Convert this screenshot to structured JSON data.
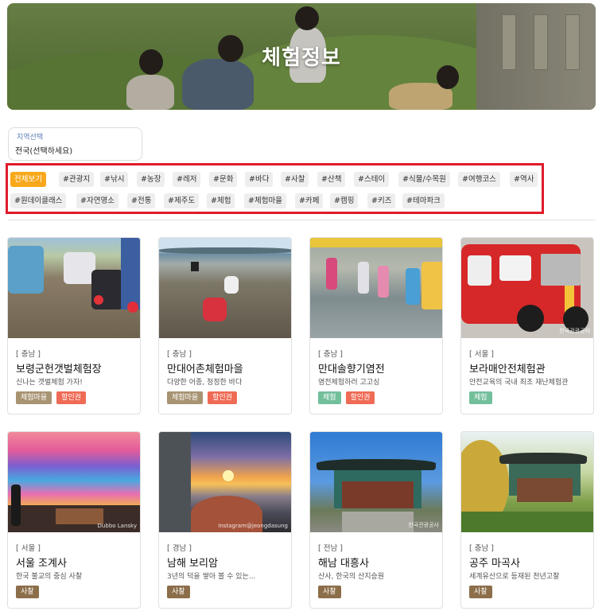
{
  "hero": {
    "title": "체험정보"
  },
  "region_select": {
    "label": "지역선택",
    "value": "전국(선택하세요)"
  },
  "tags": [
    "전체보기",
    "#관광지",
    "#낚시",
    "#농장",
    "#레저",
    "#문화",
    "#바다",
    "#사찰",
    "#산책",
    "#스테이",
    "#식물/수목원",
    "#여행코스",
    "#역사",
    "#원데이클래스",
    "#자연명소",
    "#전통",
    "#제주도",
    "#체험",
    "#체험마을",
    "#카페",
    "#캠핑",
    "#키즈",
    "#테마파크"
  ],
  "active_tag": "전체보기",
  "colors": {
    "active_tag": "#f7a81b",
    "badge_village": "#a89372",
    "badge_discount": "#ef6b55",
    "badge_experience": "#72bf9b",
    "badge_temple": "#8c6e4a",
    "highlight_border": "#e01b2a"
  },
  "cards": [
    {
      "region": "[ 충남 ]",
      "name": "보령군헌갯벌체험장",
      "desc": "신나는 갯벌체험 가자!",
      "badges": [
        "체험마을",
        "할인권"
      ]
    },
    {
      "region": "[ 충남 ]",
      "name": "만대어촌체험마을",
      "desc": "다양한 어종, 청정한 바다",
      "badges": [
        "체험마을",
        "할인권"
      ]
    },
    {
      "region": "[ 충남 ]",
      "name": "만대솔향기염전",
      "desc": "염전체험하러 고고싱",
      "badges": [
        "체험",
        "할인권"
      ]
    },
    {
      "region": "[ 서울 ]",
      "name": "보라매안전체험관",
      "desc": "안전교육의 국내 최초 재난체험관",
      "badges": [
        "체험"
      ]
    },
    {
      "region": "[ 서울 ]",
      "name": "서울 조계사",
      "desc": "한국 불교의 중심 사찰",
      "badges": [
        "사찰"
      ]
    },
    {
      "region": "[ 경남 ]",
      "name": "남해 보리암",
      "desc": "3년의 덕을 쌓아 볼 수 있는...",
      "badges": [
        "사찰"
      ]
    },
    {
      "region": "[ 전남 ]",
      "name": "해남 대흥사",
      "desc": "산사, 한국의 산지승원",
      "badges": [
        "사찰"
      ]
    },
    {
      "region": "[ 충남 ]",
      "name": "공주 마곡사",
      "desc": "세계유산으로 등재된 천년고찰",
      "badges": [
        "사찰"
      ]
    }
  ],
  "watermarks": {
    "card4": "한국관광공사",
    "card5": "Dubbo Lansky",
    "card6": "Instagram@jeongdasung",
    "card7": "한국관광공사"
  }
}
